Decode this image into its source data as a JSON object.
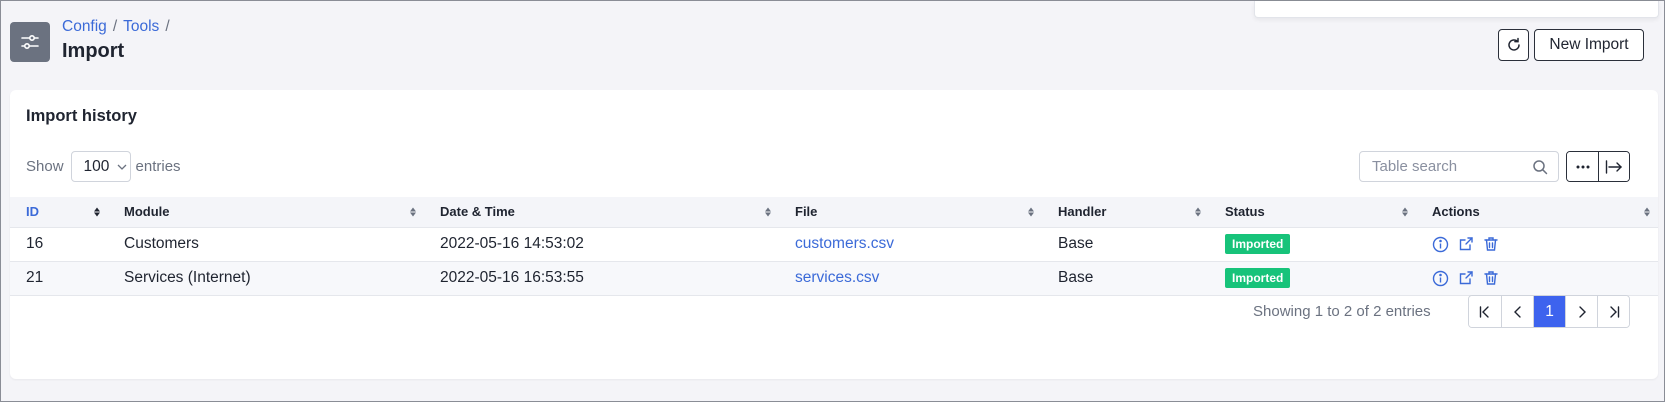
{
  "breadcrumb": {
    "items": [
      "Config",
      "Tools"
    ],
    "separator": "/"
  },
  "page": {
    "title": "Import",
    "icon": "sliders-icon"
  },
  "toolbar": {
    "refresh_icon": "refresh-icon",
    "new_import_label": "New Import"
  },
  "card": {
    "title": "Import history",
    "show_label": "Show",
    "entries_value": "100",
    "entries_label": "entries",
    "search_placeholder": "Table search"
  },
  "table": {
    "columns": [
      "ID",
      "Module",
      "Date & Time",
      "File",
      "Handler",
      "Status",
      "Actions"
    ],
    "sorted_column": "ID",
    "rows": [
      {
        "id": "16",
        "module": "Customers",
        "datetime": "2022-05-16 14:53:02",
        "file": "customers.csv",
        "handler": "Base",
        "status": "Imported"
      },
      {
        "id": "21",
        "module": "Services (Internet)",
        "datetime": "2022-05-16 16:53:55",
        "file": "services.csv",
        "handler": "Base",
        "status": "Imported"
      }
    ]
  },
  "footer": {
    "info": "Showing 1 to 2 of 2 entries",
    "current_page": "1"
  },
  "colors": {
    "accent": "#3d63ee",
    "link": "#3b6ad8",
    "status_imported": "#17c37a",
    "page_icon_bg": "#6b7280"
  }
}
